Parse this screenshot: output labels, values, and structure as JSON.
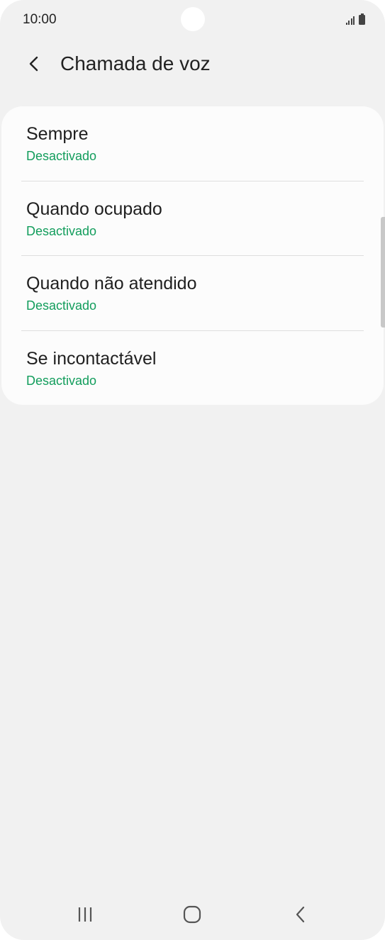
{
  "status_bar": {
    "time": "10:00"
  },
  "header": {
    "title": "Chamada de voz",
    "back_icon": "chevron-left-icon"
  },
  "list": {
    "items": [
      {
        "title": "Sempre",
        "status": "Desactivado"
      },
      {
        "title": "Quando ocupado",
        "status": "Desactivado"
      },
      {
        "title": "Quando não atendido",
        "status": "Desactivado"
      },
      {
        "title": "Se incontactável",
        "status": "Desactivado"
      }
    ]
  },
  "nav_bar": {
    "recents_icon": "recents-icon",
    "home_icon": "home-icon",
    "back_icon": "back-icon"
  },
  "colors": {
    "background": "#f1f1f1",
    "card": "#fcfcfc",
    "status_green": "#129d5c",
    "text": "#202020"
  }
}
